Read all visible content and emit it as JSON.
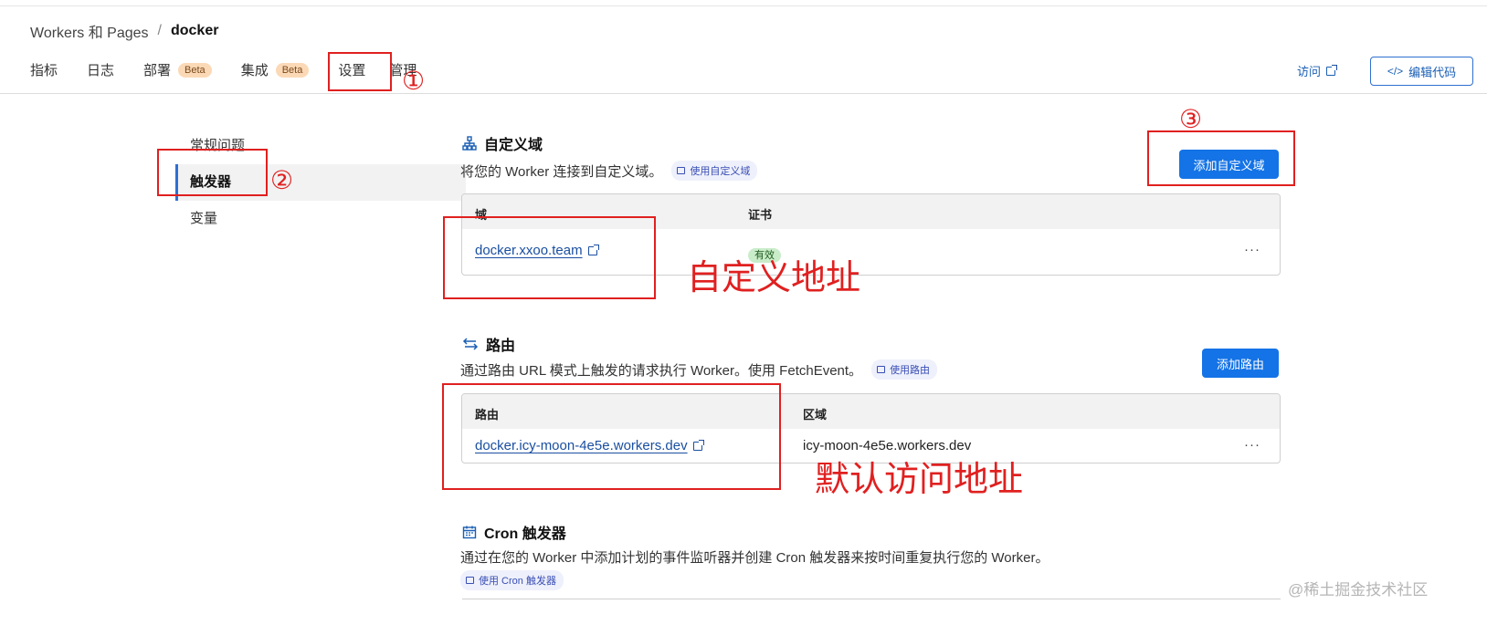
{
  "breadcrumb": {
    "parent": "Workers 和 Pages",
    "separator": "/",
    "current": "docker"
  },
  "tabs": [
    {
      "label": "指标"
    },
    {
      "label": "日志"
    },
    {
      "label": "部署",
      "badge": "Beta"
    },
    {
      "label": "集成",
      "badge": "Beta"
    },
    {
      "label": "设置"
    },
    {
      "label": "管理"
    }
  ],
  "header_actions": {
    "visit": "访问",
    "edit_code": "编辑代码"
  },
  "sidenav": [
    {
      "label": "常规问题"
    },
    {
      "label": "触发器",
      "active": true
    },
    {
      "label": "变量"
    }
  ],
  "custom_domain": {
    "title": "自定义域",
    "description": "将您的 Worker 连接到自定义域。",
    "doc_link": "使用自定义域",
    "add_button": "添加自定义域",
    "columns": [
      "域",
      "证书"
    ],
    "rows": [
      {
        "domain": "docker.xxoo.team",
        "certificate": "有效",
        "menu": "···"
      }
    ]
  },
  "routes": {
    "title": "路由",
    "description": "通过路由 URL 模式上触发的请求执行 Worker。使用 FetchEvent。",
    "doc_link": "使用路由",
    "add_button": "添加路由",
    "columns": [
      "路由",
      "区域"
    ],
    "rows": [
      {
        "route": "docker.icy-moon-4e5e.workers.dev",
        "zone": "icy-moon-4e5e.workers.dev",
        "menu": "···"
      }
    ]
  },
  "cron": {
    "title": "Cron 触发器",
    "description": "通过在您的 Worker 中添加计划的事件监听器并创建 Cron 触发器来按时间重复执行您的 Worker。",
    "doc_link": "使用 Cron 触发器"
  },
  "annotations": {
    "step1": "①",
    "step2": "②",
    "step3": "③",
    "custom_label": "自定义地址",
    "default_label": "默认访问地址"
  },
  "watermark": "@稀土掘金技术社区",
  "colors": {
    "accent": "#1473e6",
    "annotation": "#e02020",
    "beta_badge": "#fbd9b6",
    "valid_badge": "#c9ecc9"
  }
}
